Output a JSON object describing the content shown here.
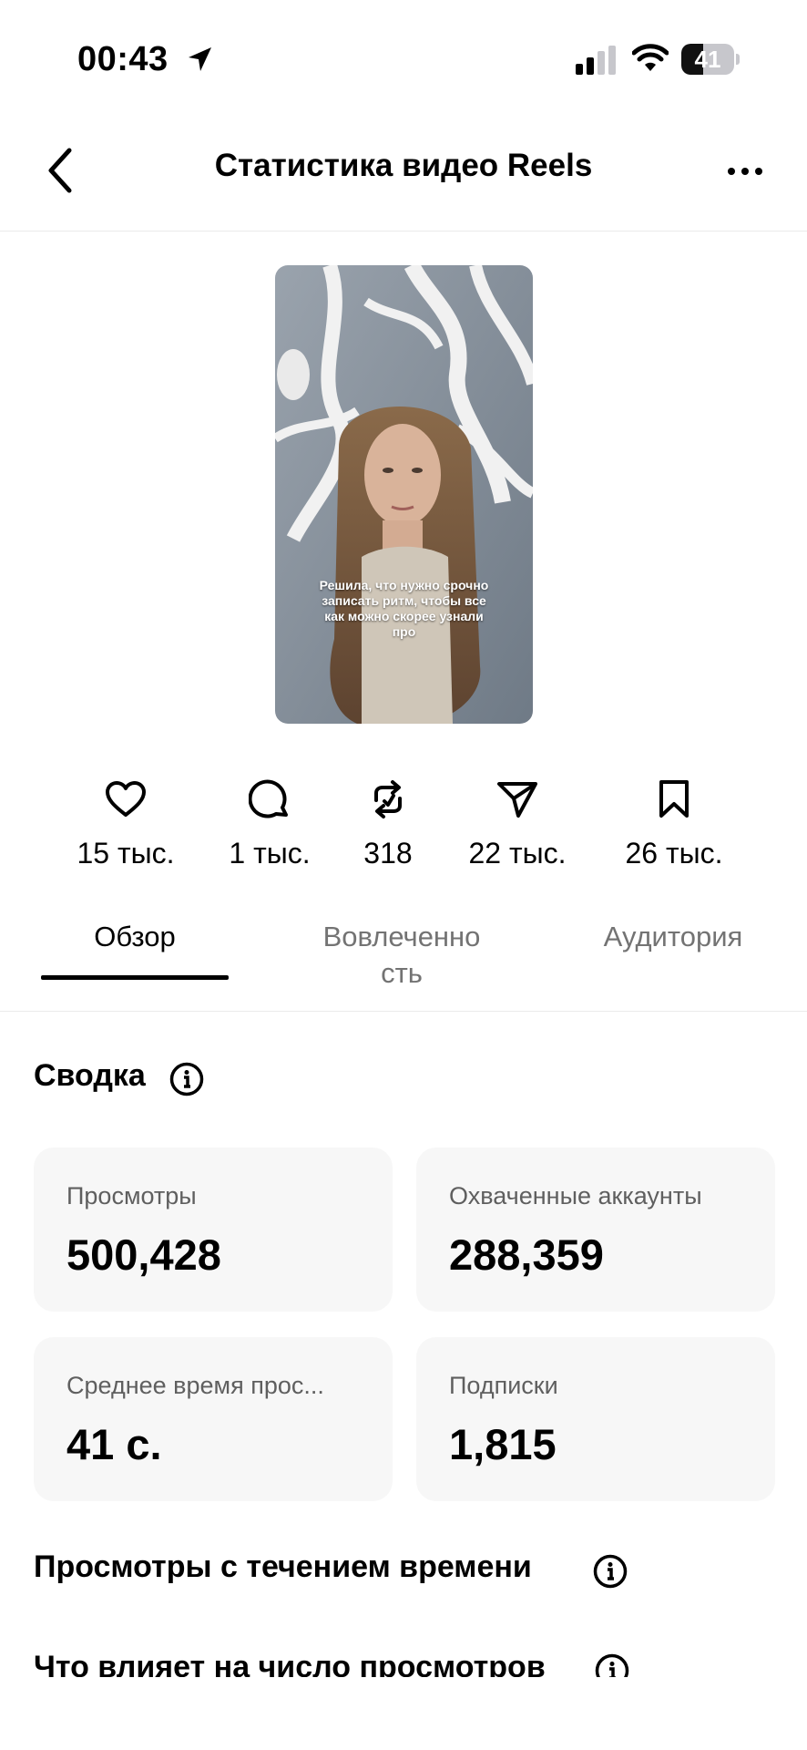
{
  "status_bar": {
    "time": "00:43",
    "battery_level": "41",
    "battery_percent": 41,
    "icons": [
      "location-arrow-icon",
      "cellular-signal-icon",
      "wifi-icon",
      "battery-icon"
    ]
  },
  "header": {
    "title": "Статистика видео Reels",
    "back_icon": "chevron-left-icon",
    "more_icon": "more-horizontal-icon"
  },
  "video": {
    "caption": "Решила, что нужно срочно записать ритм, чтобы все как можно скорее узнали про"
  },
  "engagement": [
    {
      "icon": "heart-icon",
      "value": "15 тыс."
    },
    {
      "icon": "comment-icon",
      "value": "1 тыс."
    },
    {
      "icon": "repost-icon",
      "value": "318"
    },
    {
      "icon": "send-icon",
      "value": "22 тыс."
    },
    {
      "icon": "bookmark-icon",
      "value": "26 тыс."
    }
  ],
  "tabs": [
    {
      "label": "Обзор",
      "active": true
    },
    {
      "label": "Вовлеченно сть",
      "line1": "Вовлеченно",
      "line2": "сть",
      "active": false
    },
    {
      "label": "Аудитория",
      "active": false
    }
  ],
  "summary": {
    "title": "Сводка",
    "cards": [
      {
        "label": "Просмотры",
        "value": "500,428"
      },
      {
        "label": "Охваченные аккаунты",
        "value": "288,359"
      },
      {
        "label": "Среднее время прос...",
        "value": "41 с."
      },
      {
        "label": "Подписки",
        "value": "1,815"
      }
    ]
  },
  "views_over_time": {
    "title": "Просмотры с течением времени"
  },
  "views_factors": {
    "title": "Что влияет на число просмотров"
  },
  "colors": {
    "text_primary": "#000000",
    "text_secondary": "#737373",
    "card_background": "#f7f7f7",
    "divider": "#ebebeb"
  }
}
